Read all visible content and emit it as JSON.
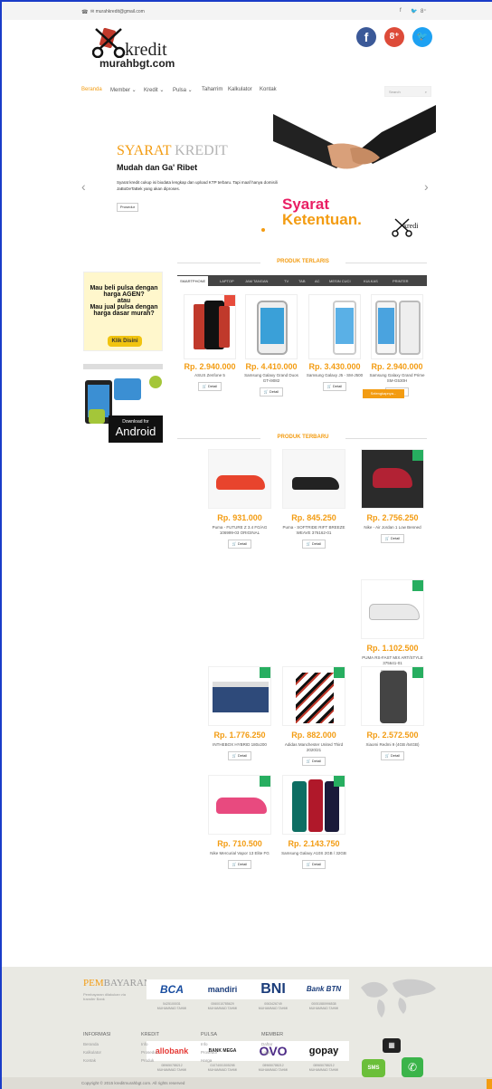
{
  "topbar": {
    "email": "murahkredit@gmail.com",
    "social": [
      "f",
      "🐦",
      "8⁺"
    ]
  },
  "logo": {
    "k": "kredit",
    "m": "murahbgt.com"
  },
  "social_big": [
    "f",
    "8⁺",
    "🐦"
  ],
  "nav": {
    "items": [
      "Beranda",
      "Member ⌄",
      "Kredit ⌄",
      "Pulsa ⌄",
      "Taharrim",
      "Kalkulator",
      "Kontak"
    ],
    "search_placeholder": "Search"
  },
  "slider": {
    "syarat_a": "SYARAT",
    "syarat_b": "KREDIT",
    "subtitle": "Mudah dan Ga' Ribet",
    "desc": "Syarat kredit cukup isi biodata lengkap dan upload KTP terbaru. Tapi maaf hanya domisili JaBoDeTaBek yang akan diproses.",
    "button": "Prosedur",
    "kt1": "Syarat",
    "kt2": "Ketentuan."
  },
  "terlaris": {
    "title": "PRODUK TERLARIS",
    "tabs": [
      "SMARTPHONE",
      "LAPTOP",
      "JAM TANGAN",
      "TV",
      "TAB",
      "AC",
      "MESIN CUCI",
      "KULKAS",
      "PRINTER"
    ],
    "products": [
      {
        "price": "Rp. 2.940.000",
        "name": "ASUS Zenfone 5",
        "detail": "Detail"
      },
      {
        "price": "Rp. 4.410.000",
        "name": "Samsung Galaxy Grand Duos GT-i9082",
        "detail": "Detail"
      },
      {
        "price": "Rp. 3.430.000",
        "name": "Samsung Galaxy J5 - SM-J500",
        "detail": "Detail"
      },
      {
        "price": "Rp. 2.940.000",
        "name": "Samsung Galaxy Grand Prime SM-G530H",
        "detail": "Detail"
      }
    ],
    "more": "Selengkapnya..."
  },
  "promo": {
    "line1": "Mau beli pulsa dengan harga AGEN?",
    "line2": "atau",
    "line3": "Mau jual pulsa dengan harga dasar murah?",
    "btn": "Klik Disini",
    "dl": "Download for",
    "android": "Android"
  },
  "terbaru": {
    "title": "PRODUK TERBARU",
    "products": [
      {
        "price": "Rp. 931.000",
        "name": "Puma - FUTURE Z 3.4 FG/AG 106999-03 ORIGINAL",
        "detail": "Detail"
      },
      {
        "price": "Rp. 845.250",
        "name": "Puma - SOFTRIDE RIFT BREEZE WEAVE 376162-01",
        "detail": "Detail"
      },
      {
        "price": "Rp. 2.756.250",
        "name": "Nike - Air Jordan 1 Low Benned",
        "detail": "Detail"
      },
      {
        "price": "Rp. 1.102.500",
        "name": "PUMA RS-FAST MIX ART/STYLE 375641-01",
        "detail": "Detail"
      },
      {
        "price": "Rp. 1.776.250",
        "name": "INTHEBOX HYBRID 180x200",
        "detail": "Detail"
      },
      {
        "price": "Rp. 882.000",
        "name": "Adidas Manchester United Third 2020/21",
        "detail": "Detail"
      },
      {
        "price": "Rp. 2.572.500",
        "name": "Xiaomi Redmi 9 (4GB /64GB)",
        "detail": "Detail"
      },
      {
        "price": "Rp. 710.500",
        "name": "Nike Mercurial Vapor 13 Elite FG",
        "detail": "Detail"
      },
      {
        "price": "Rp. 2.143.750",
        "name": "Samsung Galaxy A10S 2GB / 32GB",
        "detail": "Detail"
      }
    ]
  },
  "footer": {
    "pem_a": "PEM",
    "pem_b": "BAYARAN",
    "pem_desc": "Pembayaran dilakukan via transfer Bank",
    "banks": [
      {
        "name": "BCA",
        "acc": "5425100031",
        "holder": "MUHAMMAD TAHMI",
        "color": "#1a4ea0"
      },
      {
        "name": "mandiri",
        "acc": "0060010785629",
        "holder": "MUHAMMAD TAHMI",
        "color": "#1a3c7a"
      },
      {
        "name": "BNI",
        "acc": "0063426749",
        "holder": "MUHAMMAD TAHMI",
        "color": "#1a3c7a"
      },
      {
        "name": "Bank BTN",
        "acc": "00051580996538",
        "holder": "MUHAMMAD TAHMI",
        "color": "#1a3c7a"
      },
      {
        "name": "allobank",
        "acc": "089650788212",
        "holder": "MUHAMMAD TAHMI",
        "color": "#e53935"
      },
      {
        "name": "BANK MEGA",
        "acc": "01074001505298",
        "holder": "MUHAMMAD TAHMI",
        "color": "#222"
      },
      {
        "name": "OVO",
        "acc": "089650788212",
        "holder": "MUHAMMAD TAHMI",
        "color": "#4c2a86"
      },
      {
        "name": "gopay",
        "acc": "089650788212",
        "holder": "MUHAMMAD TAHMI",
        "color": "#0aa5d2"
      }
    ],
    "cols": [
      {
        "head": "INFORMASI",
        "links": [
          "Beranda",
          "Kalkulator",
          "Kontak"
        ]
      },
      {
        "head": "KREDIT",
        "links": [
          "Info",
          "Prosedur",
          "Produk"
        ]
      },
      {
        "head": "PULSA",
        "links": [
          "Info",
          "Prosedur",
          "Harga"
        ]
      },
      {
        "head": "MEMBER",
        "links": [
          "Daftar",
          "Login"
        ]
      }
    ],
    "sms": "SMS",
    "copyright": "Copyright © 2015 kreditmurahbgt.com. All rights reserved"
  }
}
